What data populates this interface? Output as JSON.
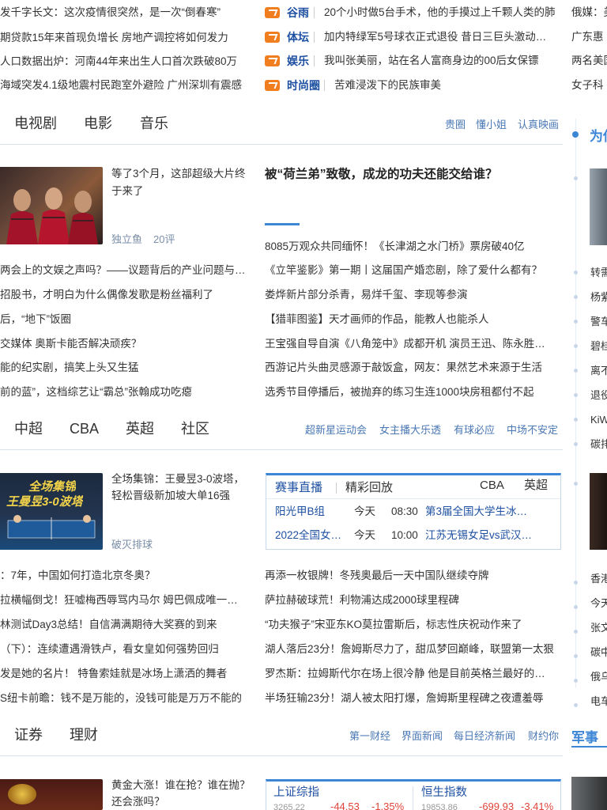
{
  "top_news": {
    "left": [
      "发千字长文：这次疫情很突然，是一次“倒春寒”",
      "期贷款15年来首现负增长 房地产调控将如何发力",
      "人口数据出炉：河南44年来出生人口首次跌破80万",
      "海域突发4.1级地震村民跑室外避险 广州深圳有震感"
    ],
    "middle": [
      {
        "category": "谷雨",
        "headline": "20个小时做5台手术，他的手摸过上千颗人类的肺"
      },
      {
        "category": "体坛",
        "headline": "加内特绿军5号球衣正式退役 昔日三巨头激动…"
      },
      {
        "category": "娱乐",
        "headline": "我叫张美丽，站在名人富商身边的00后女保镖"
      },
      {
        "category": "时尚圈",
        "headline": "苦难浸泼下的民族审美"
      }
    ],
    "right": [
      "俄媒：美",
      "广东惠",
      "两名美国",
      "女子科"
    ]
  },
  "ent": {
    "tabs": [
      "电视剧",
      "电影",
      "音乐"
    ],
    "links": [
      "贵圈",
      "懂小姐",
      "认真映画"
    ],
    "feature": {
      "title": "等了3个月，这部超级大片终于来了",
      "source": "独立鱼",
      "comments": "20评"
    },
    "headline": "被“荷兰弟”致敬，成龙的功夫还能交给谁？",
    "left_list": [
      "两会上的文娱之声吗？——议题背后的产业问题与…",
      "招股书，才明白为什么偶像发歌是粉丝福利了",
      "后，“地下”饭圈",
      "交媒体 奥斯卡能否解决顽疾？",
      "能的纪实剧，搞笑上头又生猛",
      "前的蓝”，这档综艺让“霸总”张翰成功吃瘪"
    ],
    "right_list": [
      "8085万观众共同缅怀！《长津湖之水门桥》票房破40亿",
      "《立竿鉴影》第一期丨这届国产婚恋剧，除了爱什么都有？",
      "娄烨新片部分杀青，易烊千玺、李现等参演",
      "【猎菲图鉴】天才画师的作品，能教人也能杀人",
      "王宝强自导自演《八角笼中》成都开机 演员王迅、陈永胜…",
      "西游记片头曲灵感源于敲饭盒，网友：果然艺术来源于生活",
      "选秀节目停播后，被抛弃的练习生连1000块房租都付不起"
    ]
  },
  "sports": {
    "tabs": [
      "中超",
      "CBA",
      "英超",
      "社区"
    ],
    "links": [
      "超新星运动会",
      "女主播大乐透",
      "有球必应",
      "中场不安定"
    ],
    "feature": {
      "title": "全场集锦：王曼昱3-0波塔，轻松晋级新加坡大单16强",
      "source": "破灭排球",
      "thumb_caption_1": "全场集锦",
      "thumb_caption_2": "王曼昱3-0波塔"
    },
    "score_tabs": [
      "赛事直播",
      "精彩回放",
      "CBA",
      "英超"
    ],
    "score_rows": [
      {
        "league": "阳光甲B组",
        "day": "今天",
        "time": "08:30",
        "match": "第3届全国大学生冰…"
      },
      {
        "league": "2022全国女…",
        "day": "今天",
        "time": "10:00",
        "match": "江苏无锡女足vs武汉…"
      }
    ],
    "left_list": [
      "：7年，中国如何打造北京冬奥？",
      "拉横幅倒戈！狂嘘梅西辱骂内马尔 姆巴佩成唯一…",
      "林测试Day3总结！自信满满期待大奖赛的到来",
      "（下）：连续遭遇滑铁卢，看女皇如何强势回归",
      "发是她的名片！ 特鲁索娃就是冰场上潇洒的舞者",
      "S纽卡前瞻：钱不是万能的，没钱可能是万万不能的"
    ],
    "right_list": [
      "再添一枚银牌！冬残奥最后一天中国队继续夺牌",
      "萨拉赫破球荒！利物浦达成2000球里程碑",
      "“功夫猴子”宋亚东KO莫拉雷斯后，标志性庆祝动作来了",
      "湖人落后23分！詹姆斯尽力了，甜瓜梦回巅峰，联盟第一太狠",
      "罗杰斯：拉姆斯代尔在场上很冷静 他是目前英格兰最好的…",
      "半场狂输23分！湖人被太阳打爆，詹姆斯里程碑之夜遭羞辱"
    ]
  },
  "finance": {
    "tabs": [
      "证券",
      "理财"
    ],
    "links": [
      "第一财经",
      "界面新闻",
      "每日经济新闻",
      "财约你"
    ],
    "feature": {
      "title": "黄金大涨！谁在抢？谁在抛？还会涨吗？"
    },
    "indices": [
      {
        "name": "上证综指",
        "value": "3265.22",
        "change": "-44.53",
        "pct": "-1.35%"
      },
      {
        "name": "恒生指数",
        "value": "19853.86",
        "change": "-699.93",
        "pct": "-3.41%"
      }
    ]
  },
  "sidebar": {
    "heading": "为你",
    "items": [
      "转需",
      "杨紫",
      "警车",
      "碧桂",
      "离不",
      "退役",
      "KiW",
      "碳排"
    ],
    "items2": [
      "香港",
      "今天",
      "张文",
      "碳中",
      "俄乌",
      "电车"
    ],
    "military_tab": "军事"
  },
  "colors": {
    "accent": "#1e50a2",
    "orange": "#f07d1e",
    "link": "#4a78b5",
    "down": "#e0433a"
  }
}
